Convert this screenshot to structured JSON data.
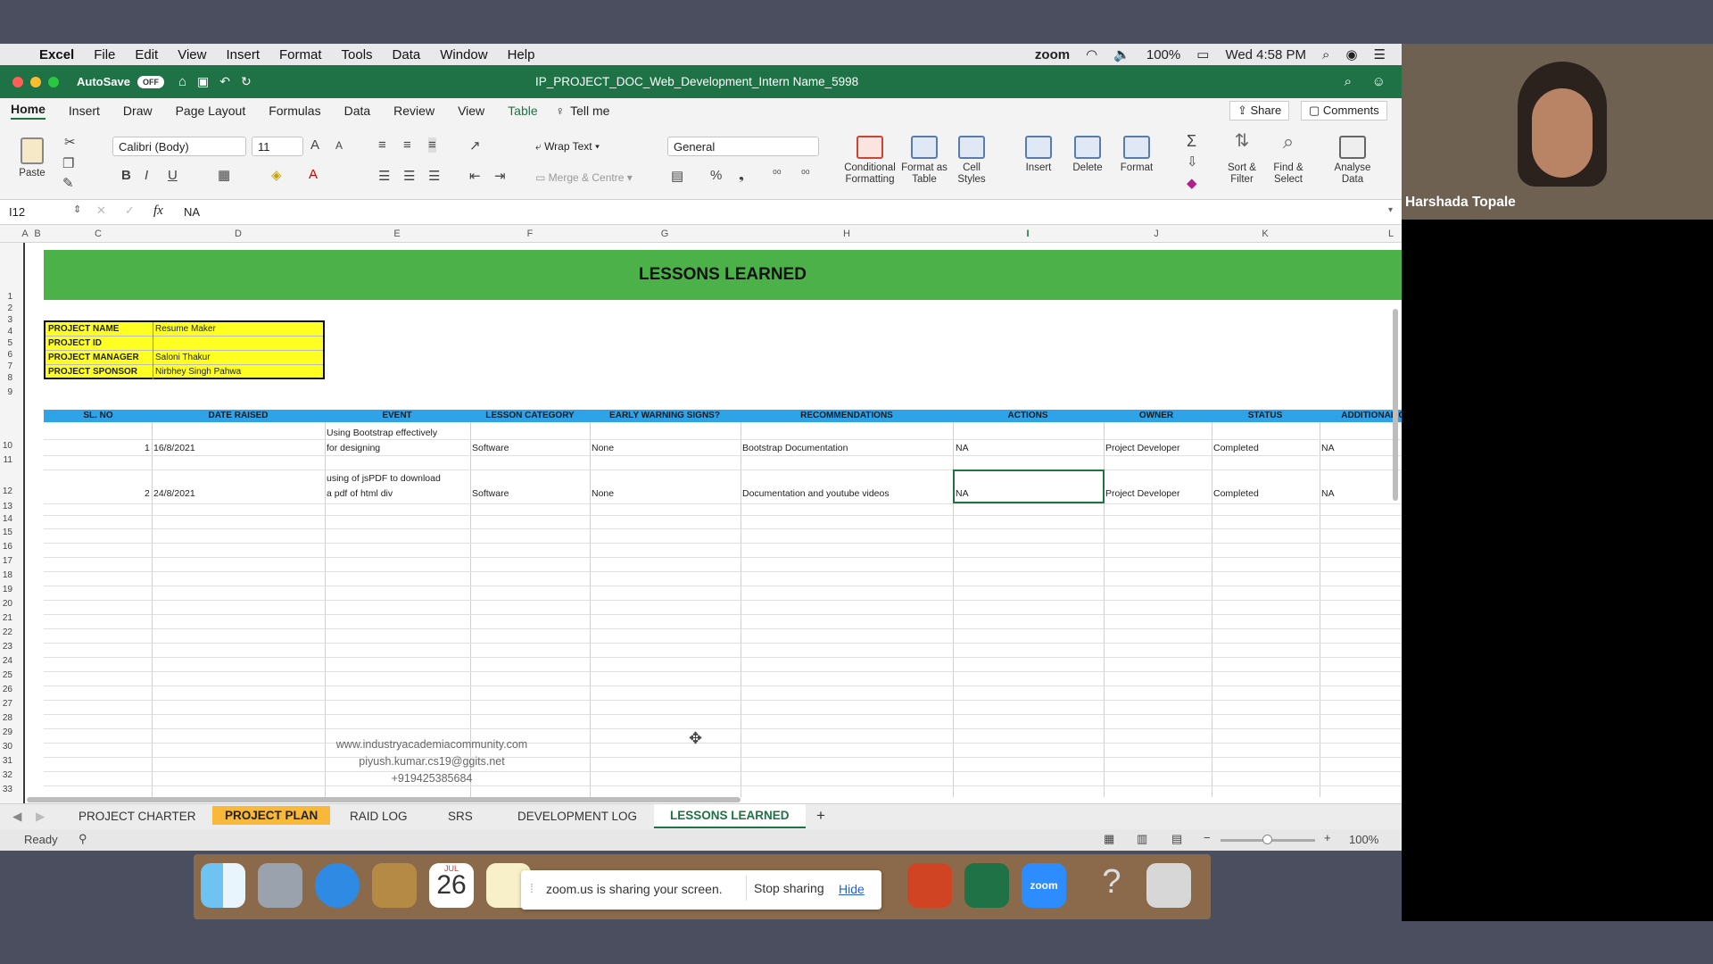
{
  "menubar": {
    "app": "Excel",
    "items": [
      "File",
      "Edit",
      "View",
      "Insert",
      "Format",
      "Tools",
      "Data",
      "Window",
      "Help"
    ],
    "zoom": "zoom",
    "battery": "100%",
    "clock": "Wed 4:58 PM"
  },
  "window": {
    "autosave": "AutoSave",
    "autosave_state": "OFF",
    "title": "IP_PROJECT_DOC_Web_Development_Intern Name_5998"
  },
  "ribbon_tabs": [
    "Home",
    "Insert",
    "Draw",
    "Page Layout",
    "Formulas",
    "Data",
    "Review",
    "View",
    "Table",
    "Tell me"
  ],
  "ribbon": {
    "share": "Share",
    "comments": "Comments",
    "paste": "Paste",
    "font": "Calibri (Body)",
    "size": "11",
    "wrap_text": "Wrap Text",
    "merge": "Merge & Centre",
    "number_format": "General",
    "conditional": "Conditional Formatting",
    "format_table": "Format as Table",
    "cell_styles": "Cell Styles",
    "insert": "Insert",
    "delete": "Delete",
    "format": "Format",
    "sort_filter": "Sort & Filter",
    "find_select": "Find & Select",
    "analyse": "Analyse Data"
  },
  "formula": {
    "cell_ref": "I12",
    "fx": "fx",
    "value": "NA"
  },
  "columns": [
    "A",
    "B",
    "C",
    "D",
    "E",
    "F",
    "G",
    "H",
    "I",
    "J",
    "K",
    "L"
  ],
  "rows": [
    "1",
    "2",
    "3",
    "4",
    "5",
    "6",
    "7",
    "8",
    "9",
    "10",
    "11",
    "12",
    "13",
    "14",
    "15",
    "16",
    "17",
    "18",
    "19",
    "20",
    "21",
    "22",
    "23",
    "24",
    "25",
    "26",
    "27",
    "28",
    "29",
    "30",
    "31",
    "32",
    "33"
  ],
  "sheet": {
    "banner": "LESSONS LEARNED",
    "info": [
      {
        "label": "PROJECT NAME",
        "value": "Resume Maker"
      },
      {
        "label": "PROJECT ID",
        "value": ""
      },
      {
        "label": "PROJECT MANAGER",
        "value": "Saloni Thakur"
      },
      {
        "label": "PROJECT SPONSOR",
        "value": "Nirbhey Singh Pahwa"
      }
    ],
    "headers": [
      "SL. NO",
      "DATE RAISED",
      "EVENT",
      "LESSON CATEGORY",
      "EARLY WARNING SIGNS?",
      "RECOMMENDATIONS",
      "ACTIONS",
      "OWNER",
      "STATUS",
      "ADDITIONAL C"
    ],
    "data_rows": [
      {
        "sl": "1",
        "date": "16/8/2021",
        "event": "Using Bootstrap effectively for designing",
        "category": "Software",
        "warning": "None",
        "recommendation": "Bootstrap Documentation",
        "actions": "NA",
        "owner": "Project Developer",
        "status": "Completed",
        "additional": "NA"
      },
      {
        "sl": "2",
        "date": "24/8/2021",
        "event": "using of jsPDF to download a pdf of html div",
        "category": "Software",
        "warning": "None",
        "recommendation": "Documentation and youtube videos",
        "actions": "NA",
        "owner": "Project Developer",
        "status": "Completed",
        "additional": "NA"
      }
    ],
    "watermark": [
      "www.industryacademiacommunity.com",
      "piyush.kumar.cs19@ggits.net",
      "+919425385684"
    ]
  },
  "sheet_tabs": [
    "PROJECT CHARTER",
    "PROJECT PLAN",
    "RAID LOG",
    "SRS",
    "DEVELOPMENT LOG",
    "LESSONS LEARNED",
    "+"
  ],
  "status": {
    "ready": "Ready",
    "zoom": "100%"
  },
  "dock": {
    "calendar_month": "JUL",
    "calendar_day": "26",
    "share_msg": "zoom.us is sharing your screen.",
    "stop": "Stop sharing",
    "hide": "Hide",
    "zoom_app": "zoom"
  },
  "video": {
    "name": "Harshada Topale"
  }
}
